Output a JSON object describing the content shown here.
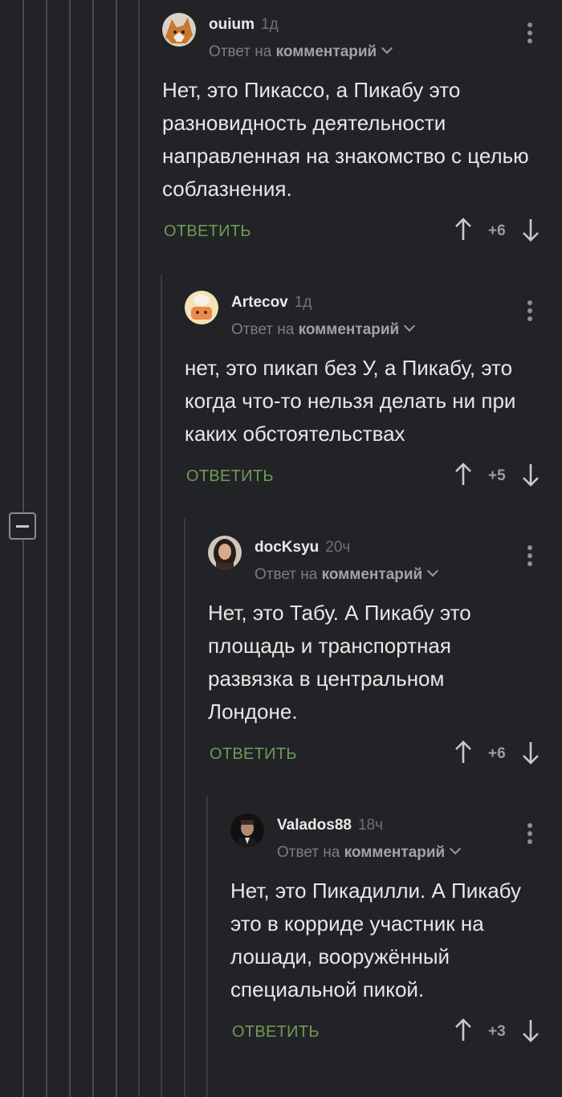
{
  "comments": [
    {
      "author": "ouium",
      "time": "1д",
      "reply_prefix": "Ответ на",
      "reply_link": "комментарий",
      "text": "Нет, это Пикассо, а Пикабу это разновидность деятельности направленная на знакомство с целью соблазнения.",
      "reply_label": "ОТВЕТИТЬ",
      "score": "+6",
      "avatar_icon": "fox-avatar-icon"
    },
    {
      "author": "Artecov",
      "time": "1д",
      "reply_prefix": "Ответ на",
      "reply_link": "комментарий",
      "text": "нет, это пикап без У, а Пикабу, это когда что-то нельзя делать ни при каких обстоятельствах",
      "reply_label": "ОТВЕТИТЬ",
      "score": "+5",
      "avatar_icon": "cartoon-avatar-icon"
    },
    {
      "author": "docKsyu",
      "time": "20ч",
      "reply_prefix": "Ответ на",
      "reply_link": "комментарий",
      "text": "Нет, это Табу. А Пикабу это площадь и транспортная развязка в центральном Лондоне.",
      "reply_label": "ОТВЕТИТЬ",
      "score": "+6",
      "avatar_icon": "portrait-avatar-icon"
    },
    {
      "author": "Valados88",
      "time": "18ч",
      "reply_prefix": "Ответ на",
      "reply_link": "комментарий",
      "text": "Нет, это Пикадилли. А Пикабу это в корриде участник на лошади, вооружённый специальной пикой.",
      "reply_label": "ОТВЕТИТЬ",
      "score": "+3",
      "avatar_icon": "godfather-avatar-icon"
    }
  ],
  "theme": {
    "background": "#222326",
    "accent_green": "#6f9a55",
    "thread_line": "#4a4b4f"
  }
}
